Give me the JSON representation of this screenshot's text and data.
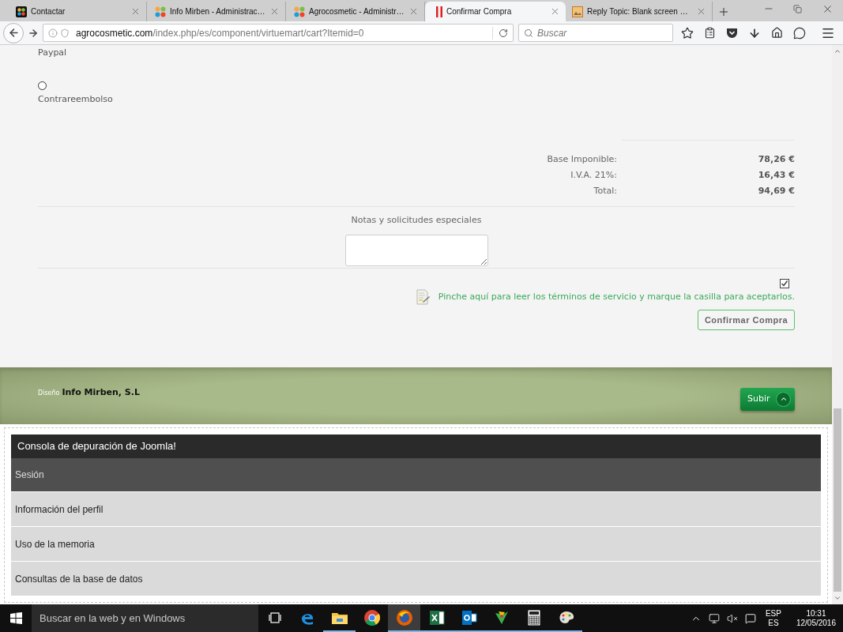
{
  "browser": {
    "tabs": [
      {
        "title": "Contactar",
        "selected": false,
        "kind": "joomla-dark"
      },
      {
        "title": "Info Mirben - Administrac…",
        "selected": false,
        "kind": "joomla"
      },
      {
        "title": "Agrocosmetic - Administr…",
        "selected": false,
        "kind": "joomla"
      },
      {
        "title": "Confirmar Compra",
        "selected": true,
        "kind": "bars"
      },
      {
        "title": "Reply Topic: Blank screen …",
        "selected": false,
        "kind": "picture"
      }
    ],
    "address": {
      "domain": "agrocosmetic.com",
      "path": "/index.php/es/component/virtuemart/cart?Itemid=0"
    },
    "search": {
      "placeholder": "Buscar"
    }
  },
  "page": {
    "payment_options": [
      {
        "label": "Paypal"
      },
      {
        "label": "Contrareembolso",
        "selected": false
      }
    ],
    "totals": [
      {
        "label": "Base Imponible:",
        "value": "78,26 €"
      },
      {
        "label": "I.V.A. 21%:",
        "value": "16,43 €"
      },
      {
        "label": "Total:",
        "value": "94,69 €"
      }
    ],
    "notes": {
      "label": "Notas y solicitudes especiales"
    },
    "terms": {
      "checked": true,
      "text": "Pinche aquí para leer los términos de servicio y marque la casilla para aceptarlos."
    },
    "confirm_button": "Confirmar Compra"
  },
  "footer": {
    "design_label": "Diseño",
    "design_company": "Info Mirben, S.L",
    "up_button": "Subir"
  },
  "debug_console": {
    "title": "Consola de depuración de Joomla!",
    "sections": [
      {
        "label": "Sesión",
        "selected": true
      },
      {
        "label": "Información del perfil",
        "selected": false
      },
      {
        "label": "Uso de la memoria",
        "selected": false
      },
      {
        "label": "Consultas de la base de datos",
        "selected": false
      }
    ]
  },
  "taskbar": {
    "search_placeholder": "Buscar en la web y en Windows",
    "apps": [
      {
        "kind": "task-view",
        "running": false,
        "selected": false
      },
      {
        "kind": "edge",
        "running": false,
        "selected": false
      },
      {
        "kind": "folder",
        "running": true,
        "selected": false
      },
      {
        "kind": "chrome",
        "running": false,
        "selected": false
      },
      {
        "kind": "firefox",
        "running": true,
        "selected": true
      },
      {
        "kind": "excel",
        "running": true,
        "selected": false
      },
      {
        "kind": "outlook",
        "running": true,
        "selected": false
      },
      {
        "kind": "green-app",
        "running": true,
        "selected": false
      },
      {
        "kind": "calculator",
        "running": true,
        "selected": false
      },
      {
        "kind": "paint",
        "running": true,
        "selected": false
      }
    ],
    "tray": {
      "language": "ESP",
      "layout": "ES",
      "time": "10:31",
      "date": "12/05/2016"
    }
  }
}
